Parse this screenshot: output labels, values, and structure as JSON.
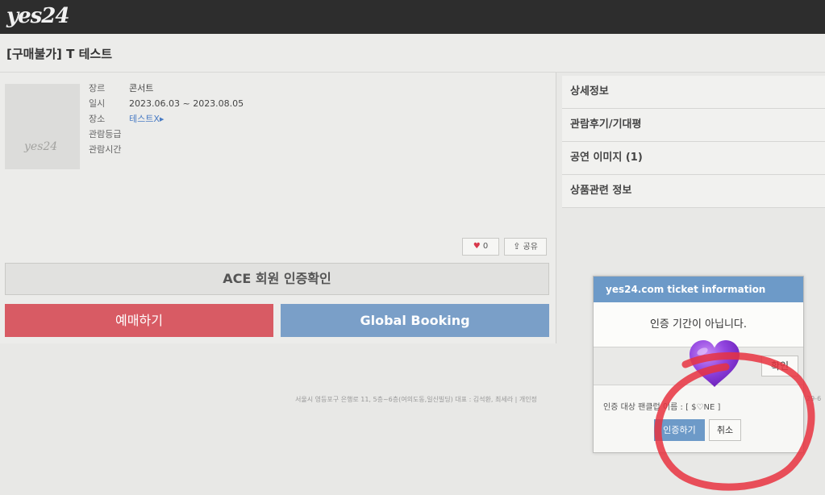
{
  "header": {
    "logo": "yes24"
  },
  "page": {
    "title": "[구매불가] T 테스트"
  },
  "poster": {
    "logo": "yes24"
  },
  "info": {
    "rows": [
      {
        "label": "장르",
        "value": "콘서트"
      },
      {
        "label": "일시",
        "value": "2023.06.03 ~ 2023.08.05"
      },
      {
        "label": "장소",
        "value": "테스트X▸"
      },
      {
        "label": "관람등급",
        "value": ""
      },
      {
        "label": "관람시간",
        "value": ""
      }
    ]
  },
  "actions": {
    "like_count": "0",
    "share_label": "공유",
    "ace_label": "ACE 회원 인증확인",
    "buy_label": "예매하기",
    "global_label": "Global Booking"
  },
  "side_menu": {
    "items": [
      "상세정보",
      "관람후기/기대평",
      "공연 이미지 (1)",
      "상품관련 정보"
    ]
  },
  "footer": {
    "text": "서울시 영등포구 은행로 11, 5층~6층(여의도동,일신빌딩)   대표 : 김석환, 최세라 | 개인정",
    "tail": "29-6"
  },
  "dialog": {
    "title": "yes24.com ticket information",
    "message": "인증 기간이 아닙니다.",
    "confirm_label": "확인",
    "fan_note": "인증 대상 팬클럽 이름 : [ $♡NE ]",
    "verify_label": "인증하기",
    "cancel_label": "취소"
  },
  "icons": {
    "heart": "heart-icon",
    "share": "share-icon",
    "purple_heart": "purple-heart-emoji"
  },
  "colors": {
    "topbar": "#2d2d2d",
    "buy_button": "#d85b64",
    "global_button": "#7a9fc8",
    "dialog_header": "#6d9ac8",
    "annotation_red": "#e8333f",
    "heart_purple": "#8b3fd9"
  }
}
